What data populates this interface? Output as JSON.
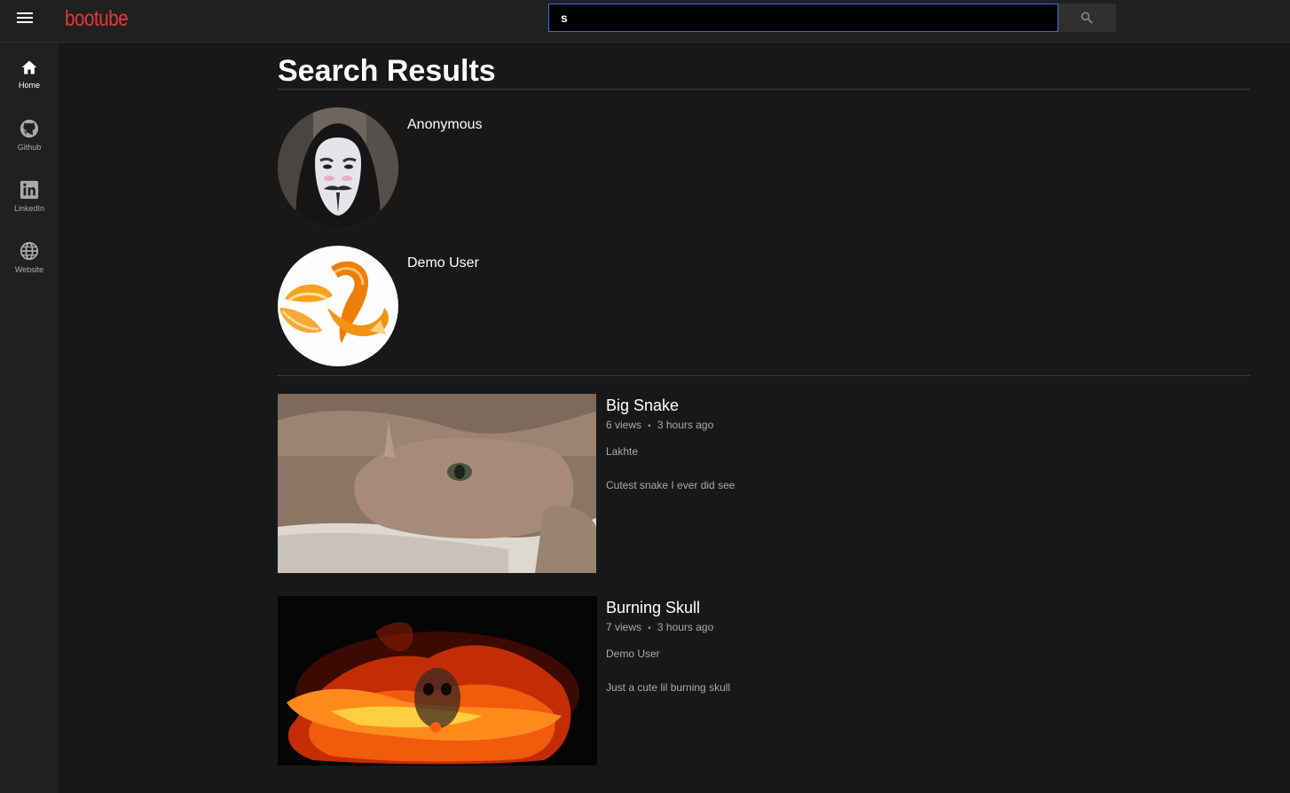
{
  "header": {
    "logo": "bootube",
    "search_value": "s",
    "menu_icon": "hamburger-menu-icon",
    "search_icon": "search-icon"
  },
  "sidebar": {
    "items": [
      {
        "label": "Home",
        "icon": "home-icon",
        "active": true
      },
      {
        "label": "Github",
        "icon": "github-icon",
        "active": false
      },
      {
        "label": "LinkedIn",
        "icon": "linkedin-icon",
        "active": false
      },
      {
        "label": "Website",
        "icon": "globe-icon",
        "active": false
      }
    ]
  },
  "main": {
    "title": "Search Results",
    "users": [
      {
        "name": "Anonymous"
      },
      {
        "name": "Demo User"
      }
    ],
    "videos": [
      {
        "title": "Big Snake",
        "views": "6 views",
        "separator": "•",
        "age": "3 hours ago",
        "channel": "Lakhte",
        "description": "Cutest snake I ever did see"
      },
      {
        "title": "Burning Skull",
        "views": "7 views",
        "separator": "•",
        "age": "3 hours ago",
        "channel": "Demo User",
        "description": "Just a cute lil burning skull"
      }
    ]
  },
  "colors": {
    "background": "#181818",
    "chrome": "#202020",
    "logo": "#e53935",
    "search_focus": "#3d6ee0",
    "secondary_text": "#aaaaaa"
  }
}
